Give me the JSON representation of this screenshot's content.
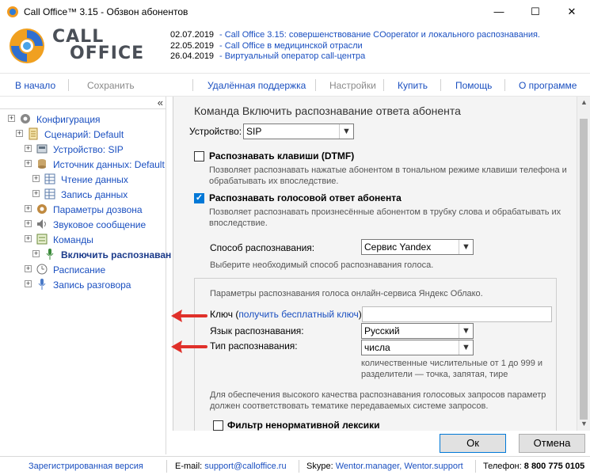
{
  "window": {
    "title": "Call Office™ 3.15 - Обзвон абонентов",
    "minimize": "—",
    "maximize": "☐",
    "close": "✕"
  },
  "logo": {
    "line1": "CALL",
    "line2": "OFFICE"
  },
  "news": [
    {
      "date": "02.07.2019",
      "text": "- Call Office 3.15: совершенствование COoperator и локального распознавания."
    },
    {
      "date": "22.05.2019",
      "text": "- Call Office в медицинской отрасли"
    },
    {
      "date": "26.04.2019",
      "text": "- Виртуальный оператор call-центра"
    }
  ],
  "nav": {
    "home": "В начало",
    "save": "Сохранить",
    "remote": "Удалённая поддержка",
    "settings": "Настройки",
    "buy": "Купить",
    "help": "Помощь",
    "about": "О программе"
  },
  "tree": {
    "collapse": "«",
    "items": [
      {
        "label": "Конфигурация",
        "icon": "gear-icon"
      },
      {
        "label": "Сценарий: Default",
        "icon": "script-icon"
      },
      {
        "label": "Устройство: SIP",
        "icon": "device-icon"
      },
      {
        "label": "Источник данных: Default",
        "icon": "database-icon"
      },
      {
        "label": "Чтение данных",
        "icon": "table-icon"
      },
      {
        "label": "Запись данных",
        "icon": "table-icon"
      },
      {
        "label": "Параметры дозвона",
        "icon": "gear-icon"
      },
      {
        "label": "Звуковое сообщение",
        "icon": "speaker-icon"
      },
      {
        "label": "Команды",
        "icon": "commands-icon"
      },
      {
        "label": "Включить распознаван",
        "icon": "microphone-icon"
      },
      {
        "label": "Расписание",
        "icon": "clock-icon"
      },
      {
        "label": "Запись разговора",
        "icon": "microphone-icon"
      }
    ]
  },
  "panel": {
    "title": "Команда Включить распознавание ответа абонента",
    "device_label": "Устройство:",
    "device_value": "SIP",
    "dtmf": {
      "label": "Распознавать клавиши (DTMF)",
      "hint1": "Позволяет распознавать нажатые абонентом в тональном режиме клавиши телефона и",
      "hint2": "обрабатывать их впоследствие.",
      "checked": false
    },
    "voice": {
      "label": "Распознавать голосовой ответ абонента",
      "hint1": "Позволяет распознавать произнесённые абонентом в трубку слова и обрабатывать их",
      "hint2": "впоследствие.",
      "checked": true
    },
    "method_label": "Способ распознавания:",
    "method_value": "Сервис Yandex",
    "method_hint": "Выберите необходимый способ распознавания голоса.",
    "yandex_params": "Параметры распознавания голоса онлайн-сервиса Яндекс Облако.",
    "key_label": "Ключ (",
    "key_link": "получить бесплатный ключ",
    "key_label_end": "):",
    "key_value": "",
    "lang_label": "Язык распознавания:",
    "lang_value": "Русский",
    "type_label": "Тип распознавания:",
    "type_value": "числа",
    "type_hint1": "количественные числительные от 1 до 999 и",
    "type_hint2": "разделители — точка, запятая, тире",
    "quality_hint1": "Для обеспечения высокого качества распознавания голосовых запросов параметр",
    "quality_hint2": "должен соответствовать тематике передаваемых системе запросов.",
    "filter_label": "Фильтр ненормативной лексики",
    "filter_checked": false
  },
  "buttons": {
    "ok": "Ок",
    "cancel": "Отмена"
  },
  "status": {
    "registered": "Зарегистрированная версия",
    "email_label": "E-mail:",
    "email": "support@calloffice.ru",
    "skype_label": "Skype:",
    "skype": "Wentor.manager, Wentor.support",
    "phone_label": "Телефон:",
    "phone": "8 800 775 0105"
  },
  "colors": {
    "link": "#1a4fc0",
    "accent": "#0078d7",
    "arrow": "#e0302a"
  }
}
